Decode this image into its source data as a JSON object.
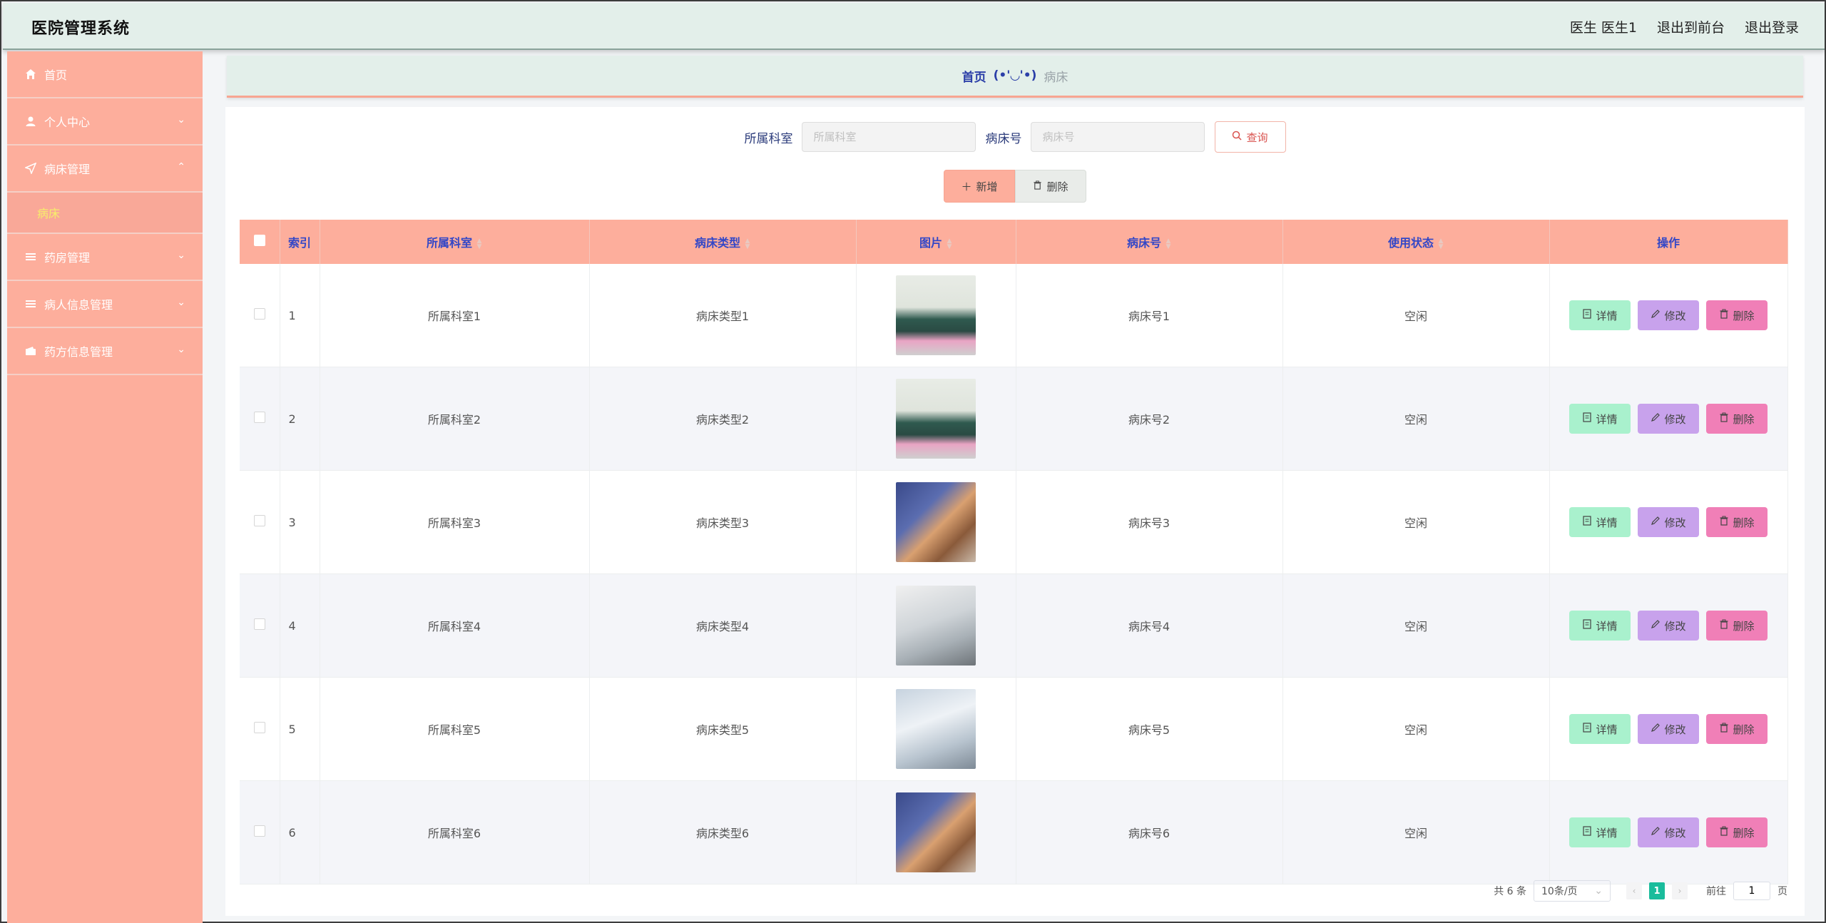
{
  "header": {
    "title": "医院管理系统",
    "user_label": "医生 医生1",
    "front_link": "退出到前台",
    "logout_link": "退出登录"
  },
  "sidebar": {
    "items": [
      {
        "label": "首页",
        "icon": "home-icon"
      },
      {
        "label": "个人中心",
        "icon": "user-icon"
      },
      {
        "label": "病床管理",
        "icon": "navigation-icon"
      },
      {
        "label": "药房管理",
        "icon": "menu-icon"
      },
      {
        "label": "病人信息管理",
        "icon": "menu-icon"
      },
      {
        "label": "药方信息管理",
        "icon": "wallet-icon"
      }
    ],
    "sub_item": "病床"
  },
  "breadcrumb": {
    "home": "首页",
    "face": "(•'◡'•)",
    "current": "病床"
  },
  "search": {
    "dept_label": "所属科室",
    "dept_placeholder": "所属科室",
    "bed_label": "病床号",
    "bed_placeholder": "病床号",
    "query_label": "查询"
  },
  "actions": {
    "add_label": "新增",
    "delete_label": "删除"
  },
  "table": {
    "headers": {
      "index": "索引",
      "dept": "所属科室",
      "bed_type": "病床类型",
      "image": "图片",
      "bed_no": "病床号",
      "status": "使用状态",
      "ops": "操作"
    },
    "rows": [
      {
        "index": "1",
        "dept": "所属科室1",
        "bed_type": "病床类型1",
        "bed_no": "病床号1",
        "status": "空闲"
      },
      {
        "index": "2",
        "dept": "所属科室2",
        "bed_type": "病床类型2",
        "bed_no": "病床号2",
        "status": "空闲"
      },
      {
        "index": "3",
        "dept": "所属科室3",
        "bed_type": "病床类型3",
        "bed_no": "病床号3",
        "status": "空闲"
      },
      {
        "index": "4",
        "dept": "所属科室4",
        "bed_type": "病床类型4",
        "bed_no": "病床号4",
        "status": "空闲"
      },
      {
        "index": "5",
        "dept": "所属科室5",
        "bed_type": "病床类型5",
        "bed_no": "病床号5",
        "status": "空闲"
      },
      {
        "index": "6",
        "dept": "所属科室6",
        "bed_type": "病床类型6",
        "bed_no": "病床号6",
        "status": "空闲"
      }
    ],
    "op_labels": {
      "detail": "详情",
      "edit": "修改",
      "remove": "删除"
    }
  },
  "pager": {
    "total": "共 6 条",
    "page_size": "10条/页",
    "current_page": "1",
    "goto_label": "前往",
    "goto_value": "1",
    "page_unit": "页"
  },
  "colors": {
    "sidebar": "#fdae9c",
    "header": "#e3efea",
    "detail_btn": "#a9f1cd",
    "edit_btn": "#c8a2ec",
    "remove_btn": "#f07fb7",
    "pager_active": "#1abc9c"
  }
}
